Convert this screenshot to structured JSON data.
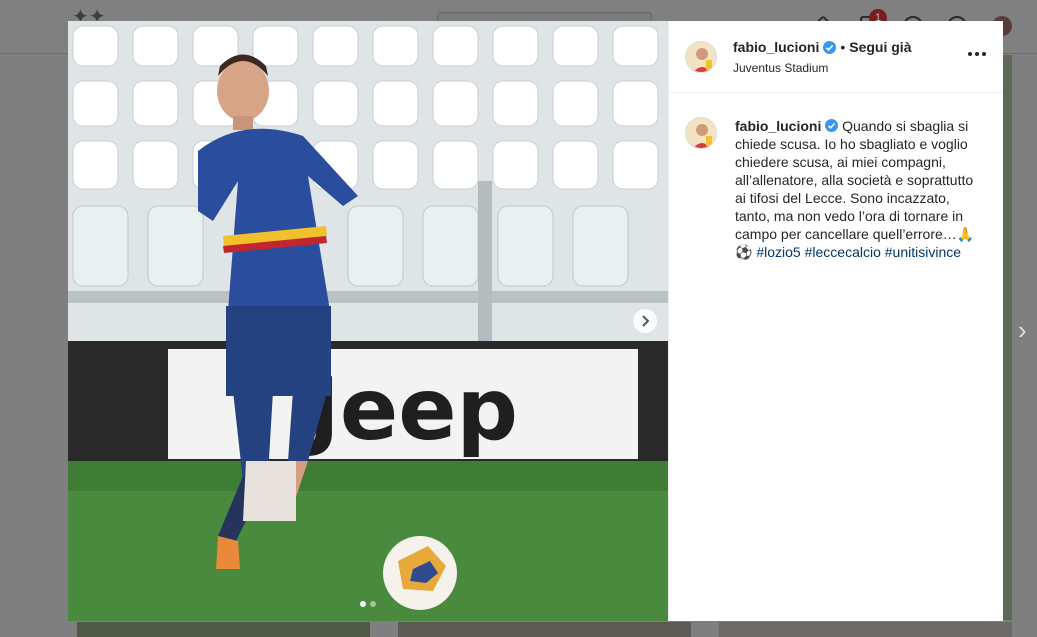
{
  "post": {
    "username": "fabio_lucioni",
    "follow_separator": "•",
    "follow_status": "Segui già",
    "location": "Juventus Stadium",
    "caption": "Quando si sbaglia si chiede scusa. Io ho sbagliato e voglio chiedere scusa, ai miei compagni, all’allenatore, alla società e soprattutto ai tifosi del Lecce. Sono incazzato, tanto, ma non vedo l’ora di tornare in campo per cancellare quell’errore…",
    "caption_emoji": "🙏",
    "hashtag_emoji": "⚽",
    "hashtags": [
      "#lozio5",
      "#leccecalcio",
      "#unitisivince"
    ],
    "photo_banner_text": "Jeep",
    "carousel_index": 0,
    "carousel_count": 2
  },
  "topbar": {
    "notification_count": "1"
  },
  "colors": {
    "verified": "#3897f0",
    "hashtag": "#00376b",
    "text": "#262626"
  },
  "icons": [
    "verified-badge-icon",
    "more-options-icon",
    "chevron-right-icon",
    "soccer-ball-icon"
  ]
}
